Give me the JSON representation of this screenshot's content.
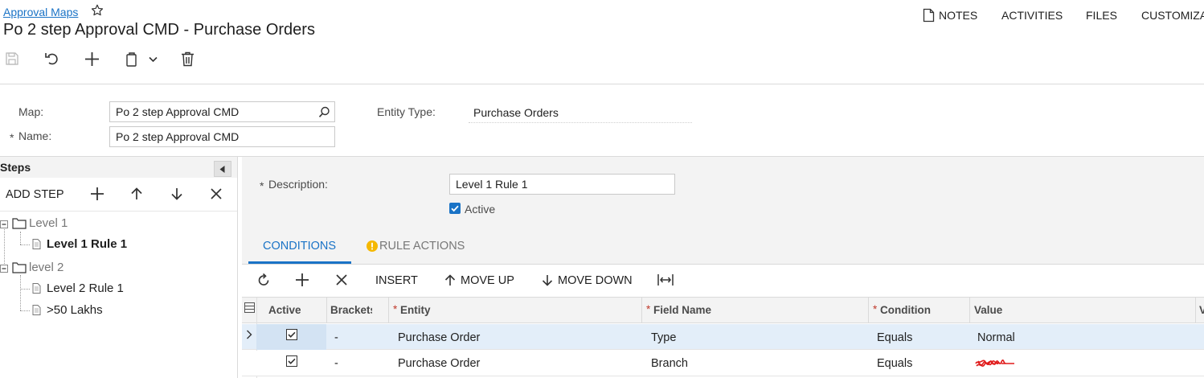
{
  "header": {
    "breadcrumb": "Approval Maps",
    "title": "Po 2 step Approval CMD - Purchase Orders",
    "nav": {
      "notes": "NOTES",
      "activities": "ACTIVITIES",
      "files": "FILES",
      "customization": "CUSTOMIZA"
    }
  },
  "form": {
    "map_label": "Map:",
    "map_value": "Po 2 step Approval CMD",
    "name_required": "*",
    "name_label": "Name:",
    "name_value": "Po 2 step Approval CMD",
    "entity_type_label": "Entity Type:",
    "entity_type_value": "Purchase Orders"
  },
  "steps": {
    "title": "Steps",
    "add_step": "ADD STEP",
    "tree": {
      "level1": "Level 1",
      "level1_rule1": "Level 1 Rule 1",
      "level2": "level 2",
      "level2_rule1": "Level 2 Rule 1",
      "level2_rule2": ">50 Lakhs"
    }
  },
  "detail": {
    "description_required": "*",
    "description_label": "Description:",
    "description_value": "Level 1 Rule 1",
    "active_label": "Active",
    "active_checked": true
  },
  "tabs": {
    "conditions": "CONDITIONS",
    "rule_actions": "RULE ACTIONS"
  },
  "grid_toolbar": {
    "insert": "INSERT",
    "move_up": "MOVE UP",
    "move_down": "MOVE DOWN"
  },
  "grid": {
    "columns": {
      "active": "Active",
      "brackets": "Brackets",
      "entity": "Entity",
      "field_name": "Field Name",
      "condition": "Condition",
      "value": "Value",
      "next": "V"
    },
    "required_marker": "*",
    "rows": [
      {
        "active": true,
        "brackets": "-",
        "entity": "Purchase Order",
        "field_name": "Type",
        "condition": "Equals",
        "value": "Normal"
      },
      {
        "active": true,
        "brackets": "-",
        "entity": "Purchase Order",
        "field_name": "Branch",
        "condition": "Equals",
        "value": ""
      }
    ]
  },
  "colors": {
    "link": "#1a73c6",
    "accent": "#1a73c6",
    "selected_row": "#e3eef9",
    "warning": "#f5b800",
    "redaction": "#e01b1b"
  }
}
